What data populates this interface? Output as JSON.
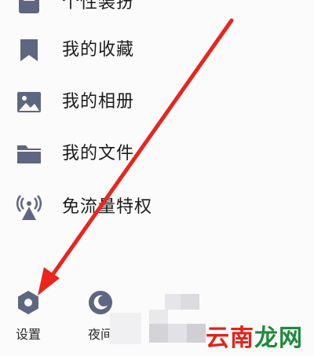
{
  "menu": {
    "items": [
      {
        "label": "个性装扮",
        "icon": "skin-icon"
      },
      {
        "label": "我的收藏",
        "icon": "bookmark-icon"
      },
      {
        "label": "我的相册",
        "icon": "image-icon"
      },
      {
        "label": "我的文件",
        "icon": "folder-icon"
      },
      {
        "label": "免流量特权",
        "icon": "signal-tower-icon"
      }
    ]
  },
  "bottom_bar": {
    "settings": {
      "label": "设置",
      "icon": "gear-hexagon-icon"
    },
    "night": {
      "label": "夜间",
      "icon": "moon-icon"
    }
  },
  "watermark": {
    "part1": "云南",
    "part2": "龙网"
  },
  "colors": {
    "icon": "#5f6680",
    "arrow": "#e8261e",
    "watermark_part1": "#e2231a",
    "watermark_part2": "#1f8a3c"
  }
}
